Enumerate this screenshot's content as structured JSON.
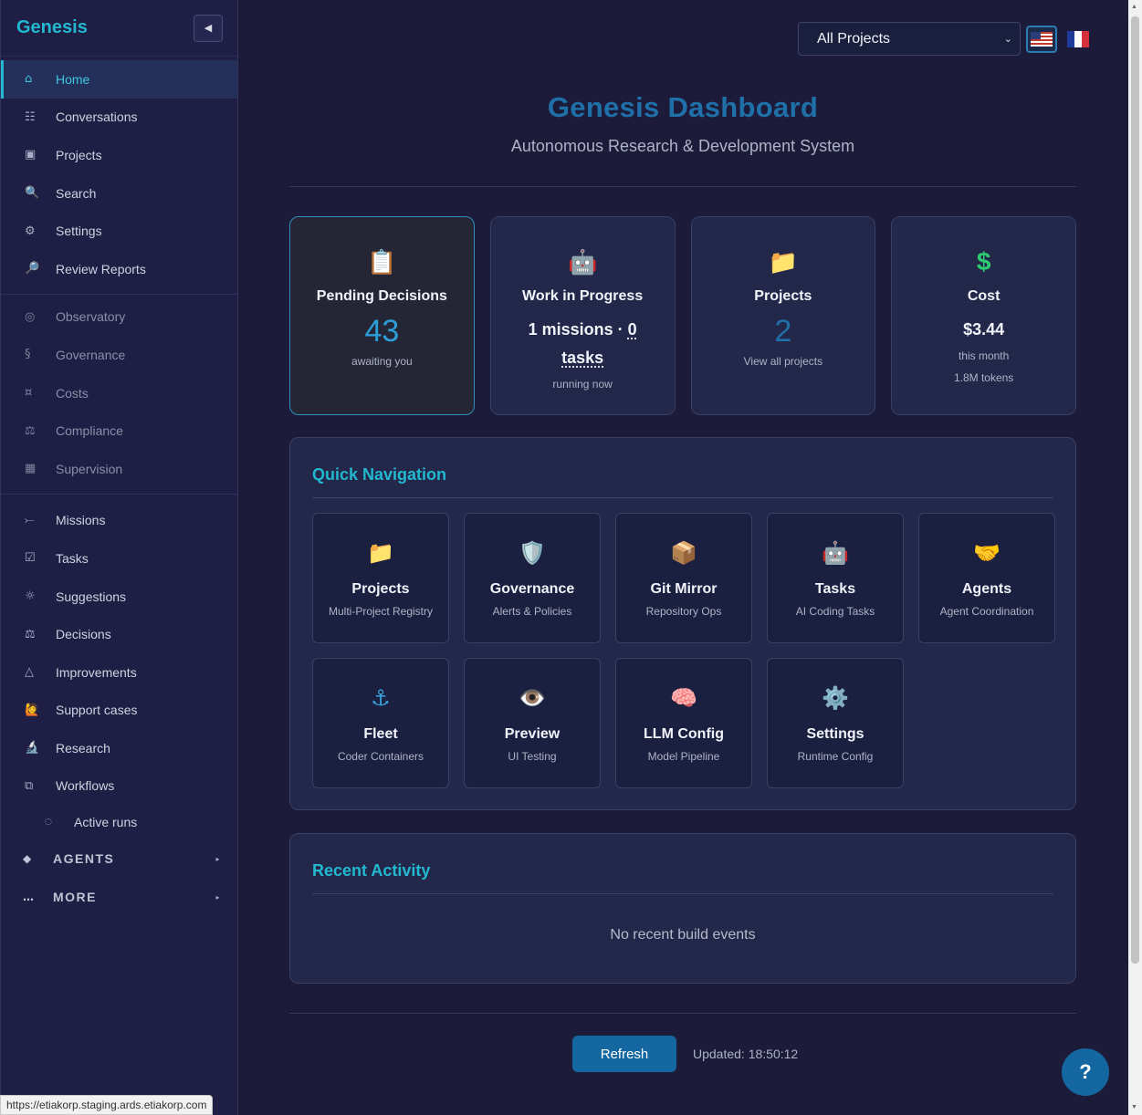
{
  "sidebar": {
    "brand": "Genesis",
    "collapse_icon": "◀",
    "group1": [
      {
        "icon": "⌂",
        "label": "Home",
        "active": true
      },
      {
        "icon": "☷",
        "label": "Conversations"
      },
      {
        "icon": "▣",
        "label": "Projects"
      },
      {
        "icon": "🔍",
        "label": "Search"
      },
      {
        "icon": "⚙",
        "label": "Settings"
      },
      {
        "icon": "🔎",
        "label": "Review Reports"
      }
    ],
    "group2": [
      {
        "icon": "◎",
        "label": "Observatory"
      },
      {
        "icon": "§",
        "label": "Governance"
      },
      {
        "icon": "¤",
        "label": "Costs"
      },
      {
        "icon": "⚖",
        "label": "Compliance"
      },
      {
        "icon": "▦",
        "label": "Supervision"
      }
    ],
    "group3": [
      {
        "icon": "⤚",
        "label": "Missions"
      },
      {
        "icon": "☑",
        "label": "Tasks"
      },
      {
        "icon": "☼",
        "label": "Suggestions"
      },
      {
        "icon": "⚖",
        "label": "Decisions"
      },
      {
        "icon": "△",
        "label": "Improvements"
      },
      {
        "icon": "🙋",
        "label": "Support cases"
      },
      {
        "icon": "🔬",
        "label": "Research"
      },
      {
        "icon": "⧉",
        "label": "Workflows"
      }
    ],
    "sub_item": {
      "icon": "◌",
      "label": "Active runs"
    },
    "sections": [
      {
        "icon": "◆",
        "label": "AGENTS",
        "caret": "▸"
      },
      {
        "icon": "…",
        "label": "MORE",
        "caret": "▸"
      }
    ],
    "status_url": "https://etiakorp.staging.ards.etiakorp.com"
  },
  "topbar": {
    "project_select": "All Projects",
    "chevron": "⌄"
  },
  "hero": {
    "title": "Genesis Dashboard",
    "subtitle": "Autonomous Research & Development System"
  },
  "stats": {
    "pending": {
      "emoji": "📋",
      "label": "Pending Decisions",
      "value": "43",
      "caption": "awaiting you"
    },
    "wip": {
      "emoji": "🤖",
      "label": "Work in Progress",
      "missions": "1 missions · ",
      "tasks_count": "0",
      "tasks_word": "tasks",
      "caption": "running now"
    },
    "projects": {
      "emoji": "📁",
      "label": "Projects",
      "value": "2",
      "caption": "View all projects"
    },
    "cost": {
      "emoji": "$",
      "label": "Cost",
      "value": "$3.44",
      "caption": "this month",
      "tokens": "1.8M tokens",
      "color": "#2ecc71"
    }
  },
  "quick_nav": {
    "title": "Quick Navigation",
    "tiles": [
      {
        "emoji": "📁",
        "title": "Projects",
        "sub": "Multi-Project Registry"
      },
      {
        "emoji": "🛡️",
        "title": "Governance",
        "sub": "Alerts & Policies"
      },
      {
        "emoji": "📦",
        "title": "Git Mirror",
        "sub": "Repository Ops"
      },
      {
        "emoji": "🤖",
        "title": "Tasks",
        "sub": "AI Coding Tasks"
      },
      {
        "emoji": "🤝",
        "title": "Agents",
        "sub": "Agent Coordination"
      },
      {
        "emoji": "⚓",
        "title": "Fleet",
        "sub": "Coder Containers"
      },
      {
        "emoji": "👁️",
        "title": "Preview",
        "sub": "UI Testing"
      },
      {
        "emoji": "🧠",
        "title": "LLM Config",
        "sub": "Model Pipeline"
      },
      {
        "emoji": "⚙️",
        "title": "Settings",
        "sub": "Runtime Config"
      }
    ]
  },
  "recent": {
    "title": "Recent Activity",
    "empty": "No recent build events"
  },
  "footer": {
    "refresh_label": "Refresh",
    "updated": "Updated: 18:50:12"
  },
  "help_label": "?",
  "colors": {
    "accent": "#22b8cf",
    "primary": "#1467a0",
    "title": "#1f6fa8"
  }
}
